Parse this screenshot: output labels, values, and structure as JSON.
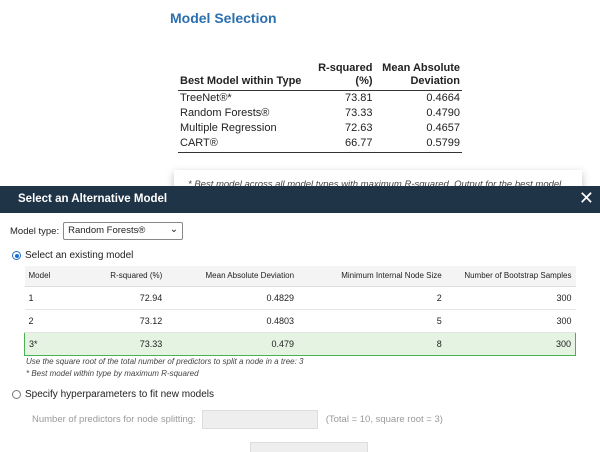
{
  "report": {
    "title": "Model Selection",
    "table": {
      "headers": {
        "type": "Best Model within Type",
        "rsq_line1": "R-squared",
        "rsq_line2": "(%)",
        "mad_line1": "Mean Absolute",
        "mad_line2": "Deviation"
      },
      "rows": [
        {
          "name": "TreeNet®*",
          "rsq": "73.81",
          "mad": "0.4664"
        },
        {
          "name": "Random Forests®",
          "rsq": "73.33",
          "mad": "0.4790"
        },
        {
          "name": "Multiple Regression",
          "rsq": "72.63",
          "mad": "0.4657"
        },
        {
          "name": "CART®",
          "rsq": "66.77",
          "mad": "0.5799"
        }
      ]
    },
    "footnote": "* Best model across all model types with maximum R-squared. Output for the best model follows."
  },
  "dialog": {
    "title": "Select an Alternative Model",
    "close_glyph": "✕",
    "model_type_label": "Model type:",
    "model_type_value": "Random Forests®",
    "option_existing": "Select an existing model",
    "alt_table": {
      "headers": [
        "Model",
        "R-squared (%)",
        "Mean Absolute Deviation",
        "Minimum Internal Node Size",
        "Number of Bootstrap Samples"
      ],
      "rows": [
        {
          "model": "1",
          "rsq": "72.94",
          "mad": "0.4829",
          "node": "2",
          "boot": "300"
        },
        {
          "model": "2",
          "rsq": "73.12",
          "mad": "0.4803",
          "node": "5",
          "boot": "300"
        },
        {
          "model": "3*",
          "rsq": "73.33",
          "mad": "0.479",
          "node": "8",
          "boot": "300"
        }
      ]
    },
    "note1": "Use the square root of the total number of predictors to split a node in a tree: 3",
    "note2": "* Best model within type by maximum R-squared",
    "option_specify": "Specify hyperparameters to fit new models",
    "split_label": "Number of predictors for node splitting:",
    "split_hint": "(Total = 10, square root = 3)"
  },
  "colors": {
    "title_blue": "#2c6fae",
    "dialog_header": "#1f3447",
    "selected_row_bg": "#e4f3e2",
    "selected_row_border": "#4caf50",
    "radio_blue": "#1a6fcf"
  }
}
